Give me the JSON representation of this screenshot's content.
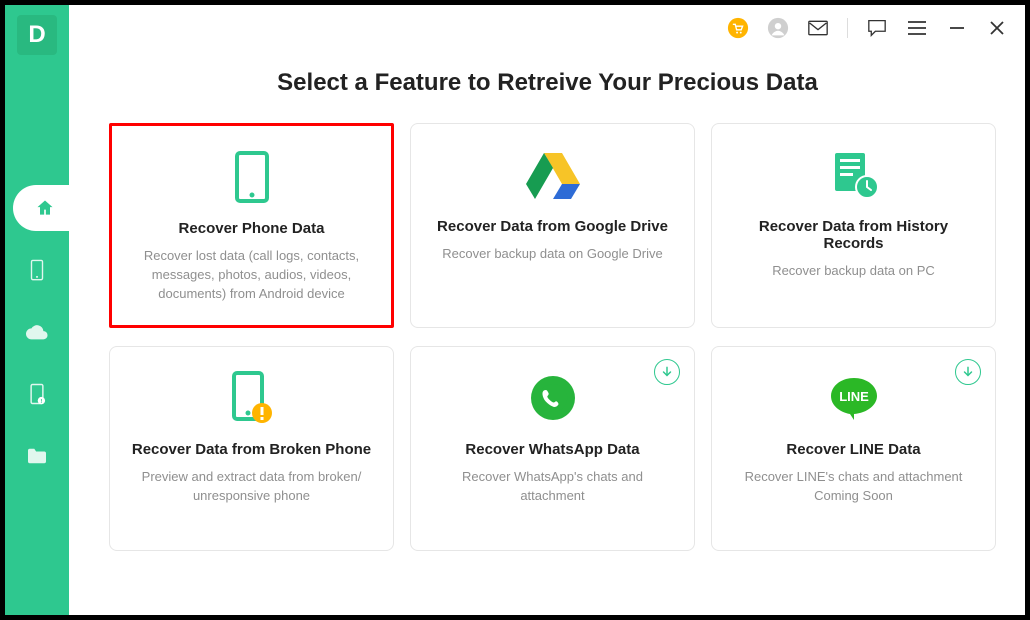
{
  "app": {
    "logo_letter": "D"
  },
  "title": "Select a Feature to Retreive Your Precious Data",
  "cards": [
    {
      "title": "Recover Phone Data",
      "desc": "Recover lost data (call logs, contacts, messages, photos, audios, videos, documents) from Android device"
    },
    {
      "title": "Recover Data from Google Drive",
      "desc": "Recover backup data on Google Drive"
    },
    {
      "title": "Recover Data from History Records",
      "desc": "Recover backup data on PC"
    },
    {
      "title": "Recover Data from Broken Phone",
      "desc": "Preview and extract data from broken/ unresponsive phone"
    },
    {
      "title": "Recover WhatsApp Data",
      "desc": "Recover WhatsApp's chats and attachment"
    },
    {
      "title": "Recover LINE Data",
      "desc": "Recover LINE's chats and attachment Coming Soon"
    }
  ],
  "line_label": "LINE"
}
